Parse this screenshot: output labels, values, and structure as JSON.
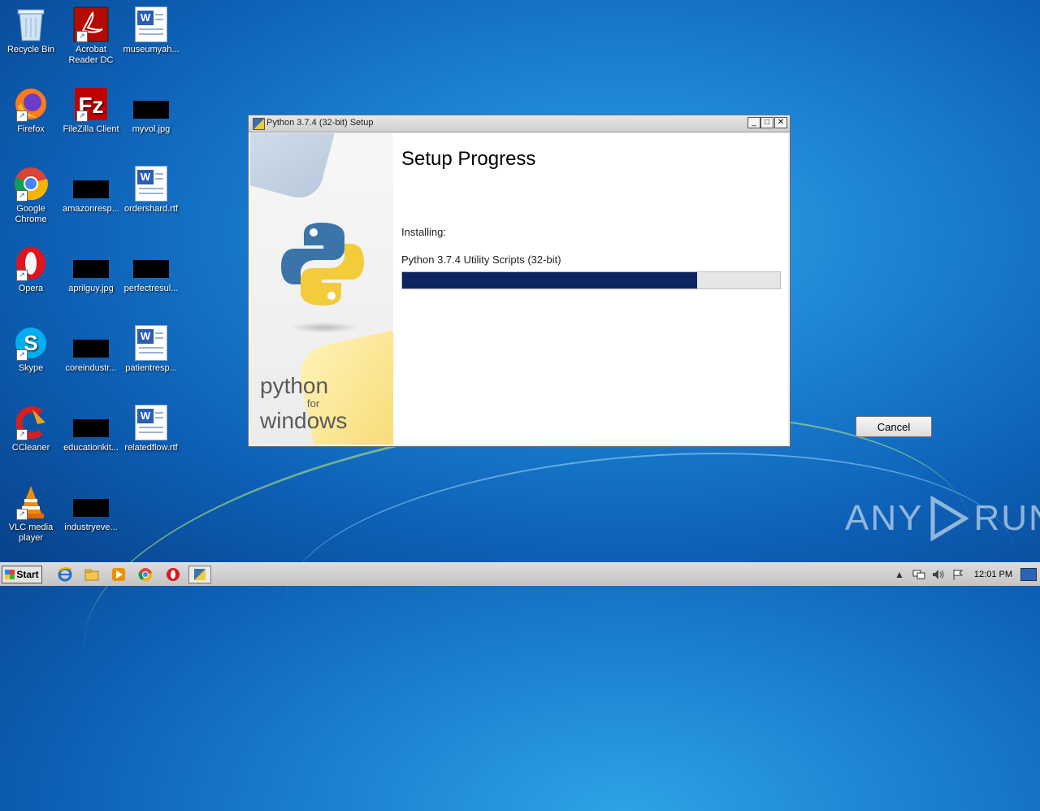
{
  "desktop": {
    "icons": [
      {
        "label": "Recycle Bin"
      },
      {
        "label": "Acrobat Reader DC"
      },
      {
        "label": "museumyah..."
      },
      {
        "label": "Firefox"
      },
      {
        "label": "FileZilla Client"
      },
      {
        "label": "myvol.jpg"
      },
      {
        "label": "Google Chrome"
      },
      {
        "label": "amazonresp..."
      },
      {
        "label": "ordershard.rtf"
      },
      {
        "label": "Opera"
      },
      {
        "label": "aprilguy.jpg"
      },
      {
        "label": "perfectresul..."
      },
      {
        "label": "Skype"
      },
      {
        "label": "coreindustr..."
      },
      {
        "label": "patientresp..."
      },
      {
        "label": "CCleaner"
      },
      {
        "label": "educationkit..."
      },
      {
        "label": "relatedflow.rtf"
      },
      {
        "label": "VLC media player"
      },
      {
        "label": "industryeve..."
      }
    ]
  },
  "window": {
    "title": "Python 3.7.4 (32-bit) Setup",
    "sidebar": {
      "brand_line1": "python",
      "brand_line2": "for",
      "brand_line3": "windows"
    },
    "heading": "Setup Progress",
    "installing_label": "Installing:",
    "current_item": "Python 3.7.4 Utility Scripts (32-bit)",
    "progress_fraction": 0.78,
    "cancel_label": "Cancel",
    "title_buttons": {
      "minimize": "_",
      "maximize": "□",
      "close": "✕"
    }
  },
  "watermark": {
    "left": "ANY",
    "right": "RUN"
  },
  "taskbar": {
    "start_label": "Start",
    "pinned": [
      "internet-explorer-icon",
      "explorer-icon",
      "media-player-icon",
      "chrome-icon",
      "opera-icon",
      "python-setup-icon"
    ],
    "clock": "12:01 PM"
  },
  "colors": {
    "progress": "#0c2560",
    "desktop": "#1a7fd1"
  }
}
